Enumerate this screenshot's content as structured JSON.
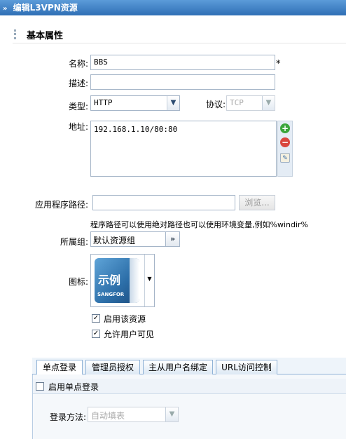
{
  "window": {
    "title": "编辑L3VPN资源"
  },
  "section": {
    "title": "基本属性"
  },
  "form": {
    "name": {
      "label": "名称:",
      "value": "BBS",
      "required_mark": "*"
    },
    "desc": {
      "label": "描述:",
      "value": ""
    },
    "type": {
      "label": "类型:",
      "value": "HTTP"
    },
    "protocol": {
      "label": "协议:",
      "value": "TCP"
    },
    "address": {
      "label": "地址:",
      "value": "192.168.1.10/80:80"
    },
    "app_path": {
      "label": "应用程序路径:",
      "value": "",
      "browse_label": "浏览..."
    },
    "app_path_hint": "程序路径可以使用绝对路径也可以使用环境变量,例如%windir%",
    "group": {
      "label": "所属组:",
      "value": "默认资源组",
      "button": "»"
    },
    "icon": {
      "label": "图标:",
      "image_text": "示例",
      "brand": "SANGFOR"
    },
    "enable_resource": {
      "label": "启用该资源",
      "checked": true
    },
    "allow_visible": {
      "label": "允许用户可见",
      "checked": true
    }
  },
  "tabs": [
    {
      "label": "单点登录",
      "active": true
    },
    {
      "label": "管理员授权",
      "active": false
    },
    {
      "label": "主从用户名绑定",
      "active": false
    },
    {
      "label": "URL访问控制",
      "active": false
    }
  ],
  "sso": {
    "enable": {
      "label": "启用单点登录",
      "checked": false
    },
    "method": {
      "label": "登录方法:",
      "value": "自动填表"
    }
  },
  "icons": {
    "title_chevron": "double-chevron-right-icon",
    "add": "add-icon",
    "remove": "remove-icon",
    "edit": "edit-icon",
    "dropdown": "chevron-down-icon"
  }
}
